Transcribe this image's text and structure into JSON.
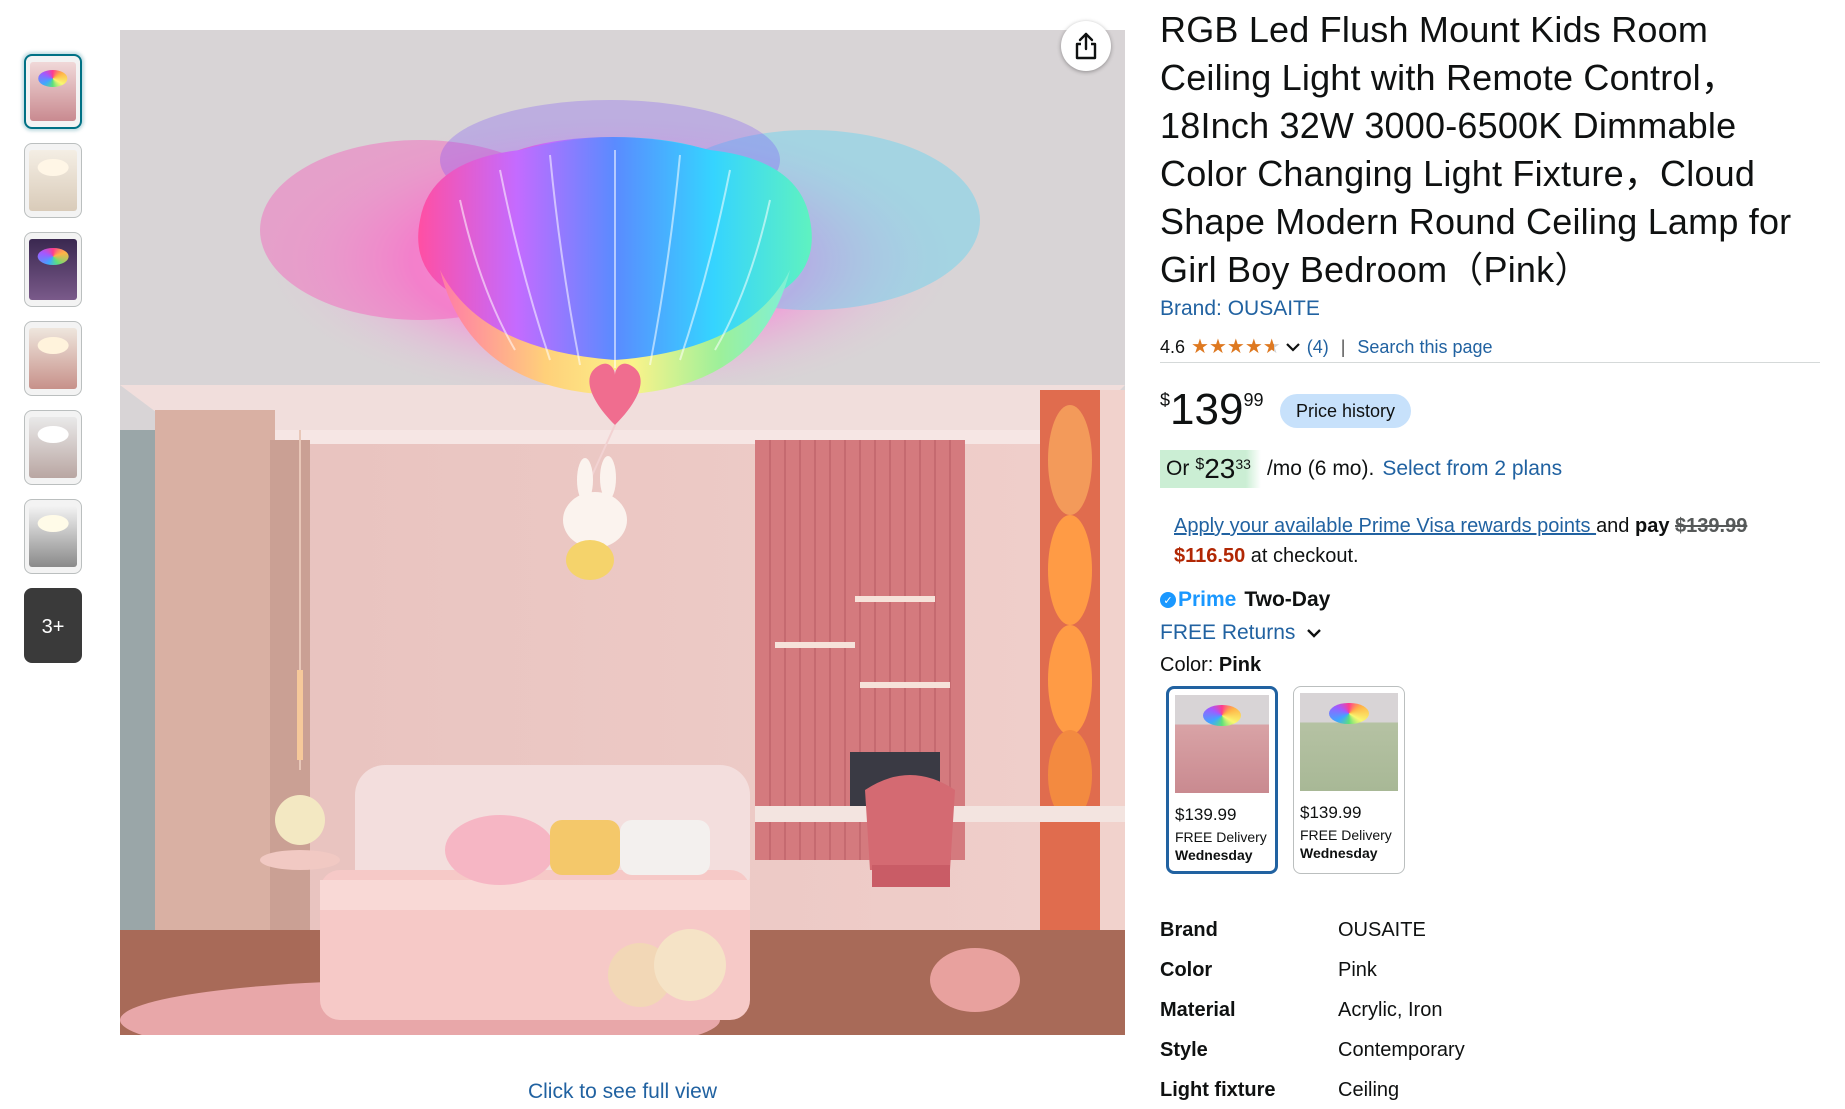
{
  "gallery": {
    "thumbnails": [
      {
        "label": "",
        "colors": [
          "#7a4a5a",
          "#d8a5a8"
        ]
      },
      {
        "label": "",
        "colors": [
          "#dcdcdc",
          "#f2e6d8"
        ]
      },
      {
        "label": "",
        "colors": [
          "#2a1e3a",
          "#c8a0c8"
        ]
      },
      {
        "label": "",
        "colors": [
          "#d6c9c0",
          "#c48f87"
        ]
      },
      {
        "label": "",
        "colors": [
          "#c9c9c9",
          "#b9a6a2"
        ]
      },
      {
        "label": "",
        "colors": [
          "#e6e6e6",
          "#9a9a9a"
        ]
      }
    ],
    "more_label": "3+",
    "share_icon": "share-icon",
    "full_view_label": "Click to see full view"
  },
  "product": {
    "title": "RGB Led Flush Mount Kids Room Ceiling Light with Remote Control，18Inch 32W 3000-6500K Dimmable Color Changing Light Fixture，Cloud Shape Modern Round Ceiling Lamp for Girl Boy Bedroom（Pink）",
    "brand_link": "Brand: OUSAITE",
    "rating_value": "4.6",
    "rating_stars": 4.6,
    "review_count": "(4)",
    "separator": "|",
    "search_link": "Search this page"
  },
  "price": {
    "symbol": "$",
    "whole": "139",
    "fraction": "99",
    "history_label": "Price history"
  },
  "installment": {
    "prefix": "Or",
    "symbol": "$",
    "amount": "23",
    "fraction": "33",
    "suffix": "/mo (6 mo).",
    "plans_link": "Select from 2 plans"
  },
  "rewards": {
    "link": "Apply your available Prime Visa rewards points ",
    "and": "and ",
    "pay": "pay",
    "old_price": "$139.99",
    "new_price": "$116.50",
    "tail": " at checkout."
  },
  "delivery": {
    "prime_label": "Prime",
    "two_day": "Two-Day",
    "free_returns": "FREE Returns"
  },
  "color": {
    "label": "Color: ",
    "selected": "Pink",
    "options": [
      {
        "price": "$139.99",
        "delivery": "FREE Delivery",
        "day": "Wednesday",
        "wall": "#d9a3a6"
      },
      {
        "price": "$139.99",
        "delivery": "FREE Delivery",
        "day": "Wednesday",
        "wall": "#a8b896"
      }
    ]
  },
  "specs": [
    {
      "key": "Brand",
      "value": "OUSAITE"
    },
    {
      "key": "Color",
      "value": "Pink"
    },
    {
      "key": "Material",
      "value": "Acrylic, Iron"
    },
    {
      "key": "Style",
      "value": "Contemporary"
    },
    {
      "key": "Light fixture form",
      "value": "Ceiling"
    }
  ],
  "colors": {
    "link": "#2162a1",
    "star": "#de7921",
    "prime": "#1a98ff",
    "deal": "#b12704",
    "price_history_bg": "#c7e1fb",
    "install_bg": "#cbeed4"
  }
}
